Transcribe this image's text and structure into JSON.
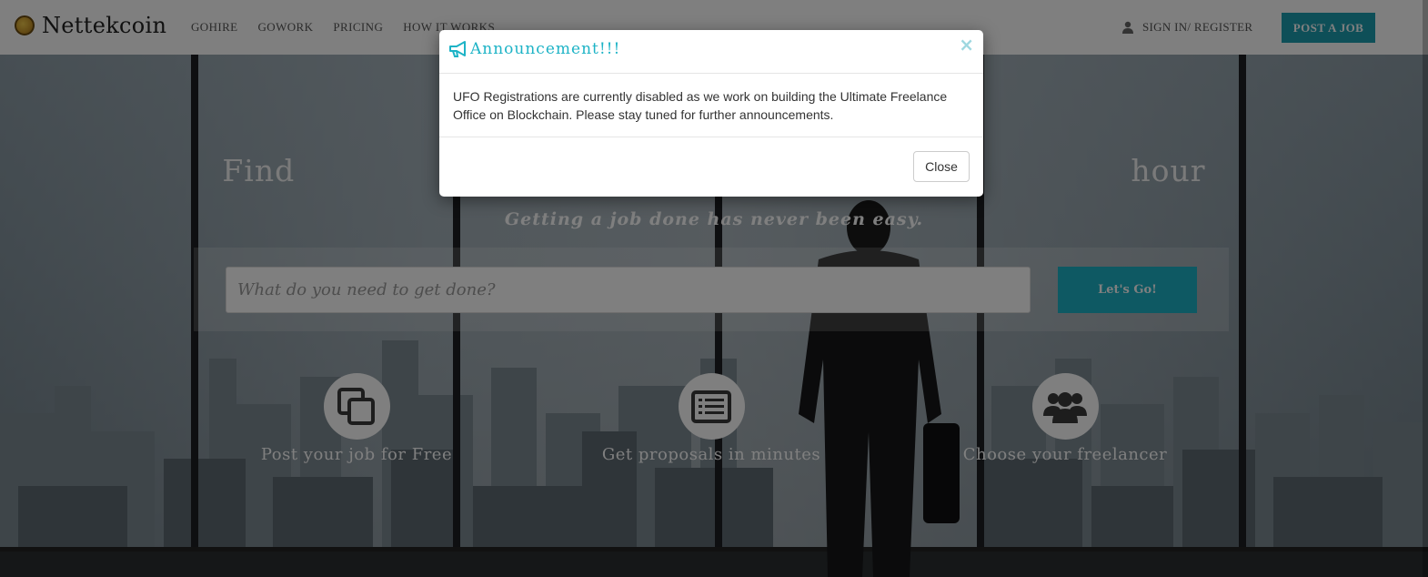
{
  "brand": {
    "name": "Nettekcoin"
  },
  "nav": {
    "links": [
      "GOHIRE",
      "GOWORK",
      "PRICING",
      "HOW IT WORKS"
    ],
    "signin": "SIGN IN/ REGISTER",
    "post_job": "POST A JOB"
  },
  "hero": {
    "title": "Find                                                                                hour",
    "subtitle": "Getting a job done has never been easy.",
    "search_placeholder": "What do you need to get done?",
    "go_label": "Let's Go!"
  },
  "features": [
    {
      "label": "Post your job for Free",
      "icon": "copy-icon"
    },
    {
      "label": "Get proposals in minutes",
      "icon": "list-alt-icon"
    },
    {
      "label": "Choose your freelancer",
      "icon": "users-icon"
    }
  ],
  "modal": {
    "title": "Announcement!!!",
    "close_x": "×",
    "body": "UFO Registrations are currently disabled as we work on building the Ultimate Freelance Office on Blockchain. Please stay tuned for further announcements.",
    "close_label": "Close"
  },
  "colors": {
    "accent": "#1db3c6",
    "post_job": "#1d9fb1"
  }
}
